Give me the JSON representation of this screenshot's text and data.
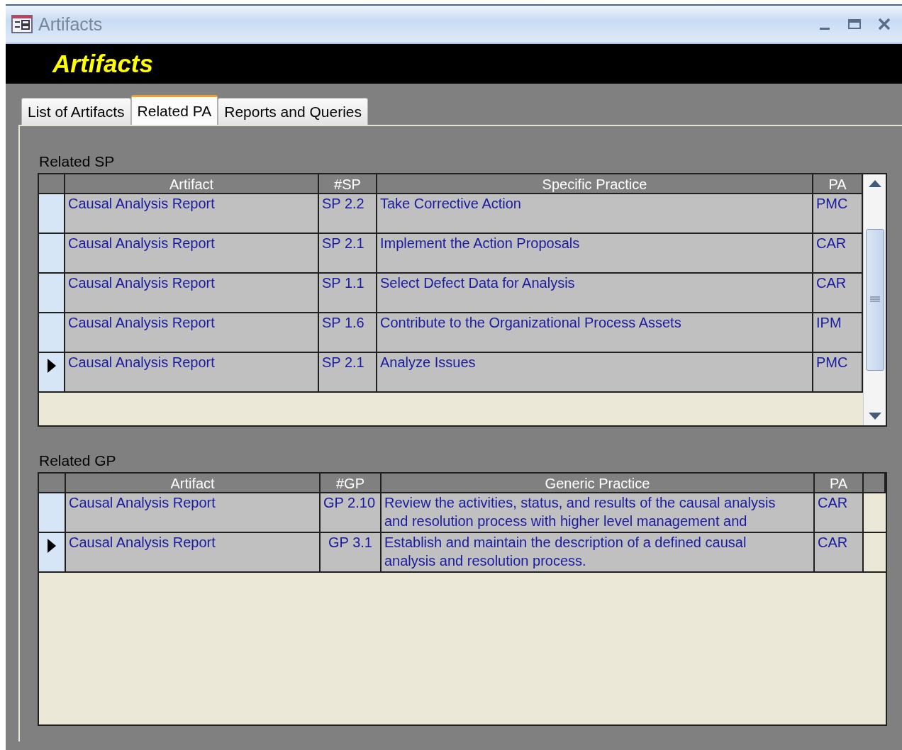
{
  "window": {
    "title": "Artifacts"
  },
  "header": {
    "title": "Artifacts"
  },
  "tabs": [
    {
      "label": "List of Artifacts",
      "selected": false
    },
    {
      "label": "Related PA",
      "selected": true
    },
    {
      "label": "Reports and Queries",
      "selected": false
    }
  ],
  "related_sp": {
    "label": "Related SP",
    "columns": [
      "Artifact",
      "#SP",
      "Specific Practice",
      "PA"
    ],
    "rows": [
      {
        "artifact": "Causal Analysis Report",
        "number": "SP 2.2",
        "practice": "Take Corrective Action",
        "pa": "PMC",
        "selected": false
      },
      {
        "artifact": "Causal Analysis Report",
        "number": "SP 2.1",
        "practice": "Implement the Action Proposals",
        "pa": "CAR",
        "selected": false
      },
      {
        "artifact": "Causal Analysis Report",
        "number": "SP 1.1",
        "practice": "Select Defect Data for Analysis",
        "pa": "CAR",
        "selected": false
      },
      {
        "artifact": "Causal Analysis Report",
        "number": "SP 1.6",
        "practice": "Contribute to the Organizational Process Assets",
        "pa": "IPM",
        "selected": false
      },
      {
        "artifact": "Causal Analysis Report",
        "number": "SP 2.1",
        "practice": "Analyze Issues",
        "pa": "PMC",
        "selected": true
      }
    ]
  },
  "related_gp": {
    "label": "Related GP",
    "columns": [
      "Artifact",
      "#GP",
      "Generic Practice",
      "PA"
    ],
    "rows": [
      {
        "artifact": "Causal Analysis Report",
        "number": "GP 2.10",
        "practice": "Review the activities, status, and results of the causal analysis and resolution process with higher level management and",
        "pa": "CAR",
        "selected": false
      },
      {
        "artifact": "Causal Analysis Report",
        "number": "GP 3.1",
        "practice": "Establish and maintain the description of a defined causal analysis and resolution process.",
        "pa": "CAR",
        "selected": true
      }
    ]
  }
}
